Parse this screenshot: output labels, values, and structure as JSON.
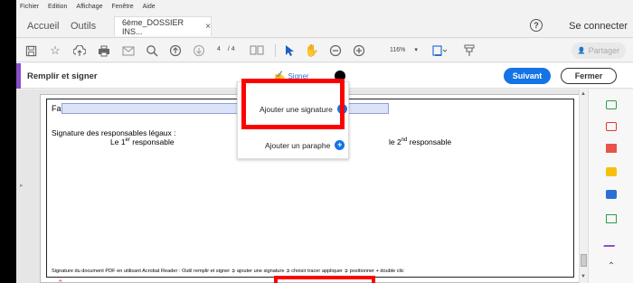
{
  "menu": [
    "Fichier",
    "Edition",
    "Affichage",
    "Fenêtre",
    "Aide"
  ],
  "tabs": {
    "home": "Accueil",
    "tools": "Outils",
    "document": "6ème_DOSSIER INS...",
    "document_close": "×"
  },
  "header": {
    "help": "?",
    "connect": "Se connecter"
  },
  "toolbar": {
    "page_current": "4",
    "page_total": "/ 4",
    "zoom": "116%",
    "share": "Partager",
    "icons": [
      "save-icon",
      "bookmark-star-icon",
      "cloud-upload-icon",
      "print-icon",
      "mail-icon",
      "search-icon",
      "prev-page-icon",
      "next-page-icon",
      "page-thumbs-icon",
      "select-cursor-icon",
      "hand-icon",
      "zoom-out-icon",
      "zoom-in-icon",
      "fit-page-icon",
      "comment-icon"
    ]
  },
  "fillbar": {
    "title": "Remplir et signer",
    "sign": "Signer",
    "next": "Suivant",
    "close": "Fermer",
    "accent_color": "#8a4fc7",
    "primary_color": "#1473e6"
  },
  "document": {
    "fait_label": "Fait à",
    "signatures_title": "Signature des responsables légaux :",
    "resp1": "Le 1er responsable",
    "resp2": "le 2nd responsable",
    "footnote": "Signature du document PDF en utilisant Acrobat Reader : Outil remplir et signer ➲ ajouter une signature ➲ choisir tracer appliquer ➲ positionner + double clic"
  },
  "popup": {
    "add_signature": "Ajouter une signature",
    "add_initials": "Ajouter un paraphe"
  },
  "right_panel": {
    "icons": [
      "export-pdf-icon",
      "create-pdf-icon",
      "organize-pages-icon",
      "comment-tool-icon",
      "combine-files-icon",
      "edit-pdf-icon",
      "fill-sign-icon",
      "more-tools-icon"
    ]
  },
  "highlight_color": "#ff0000"
}
